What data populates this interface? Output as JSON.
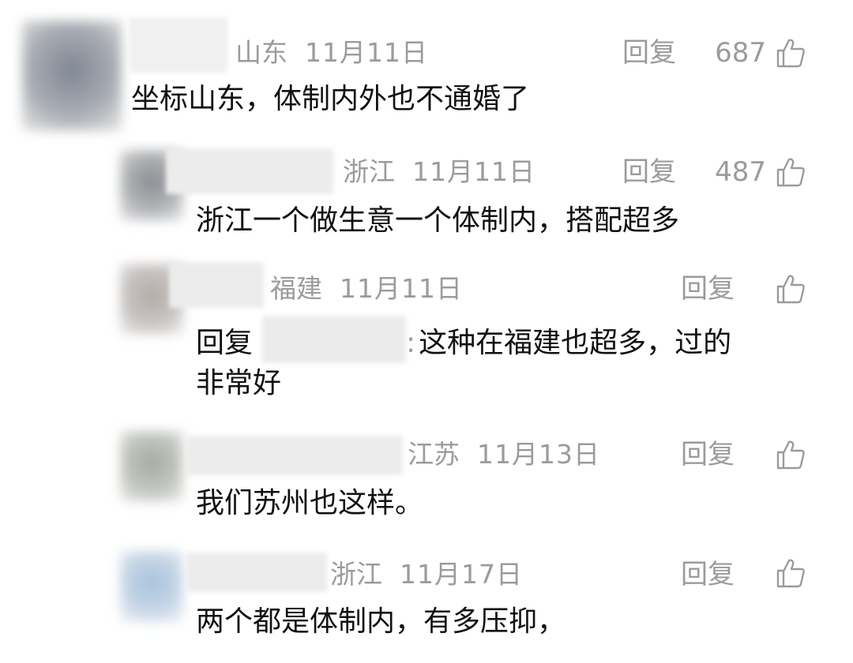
{
  "colors": {
    "meta_text": "#9b9b9b",
    "body_text": "#111111",
    "avatar_blur": "#8f939a"
  },
  "comments": [
    {
      "region": "山东",
      "date": "11月11日",
      "reply_label": "回复",
      "likes": "687",
      "text": "坐标山东，体制内外也不通婚了"
    },
    {
      "region": "浙江",
      "date": "11月11日",
      "reply_label": "回复",
      "likes": "487",
      "text": "浙江一个做生意一个体制内，搭配超多"
    },
    {
      "region": "福建",
      "date": "11月11日",
      "reply_label": "回复",
      "likes": "",
      "reply_prefix": "回复",
      "reply_colon": ":",
      "text_line1": "这种在福建也超多，过的",
      "text_line2": "非常好"
    },
    {
      "region": "江苏",
      "date": "11月13日",
      "reply_label": "回复",
      "likes": "",
      "text": "我们苏州也这样。"
    },
    {
      "region": "浙江",
      "date": "11月17日",
      "reply_label": "回复",
      "likes": "",
      "text": "两个都是体制内，有多压抑，"
    }
  ],
  "icons": {
    "like": "thumbs-up-icon"
  }
}
